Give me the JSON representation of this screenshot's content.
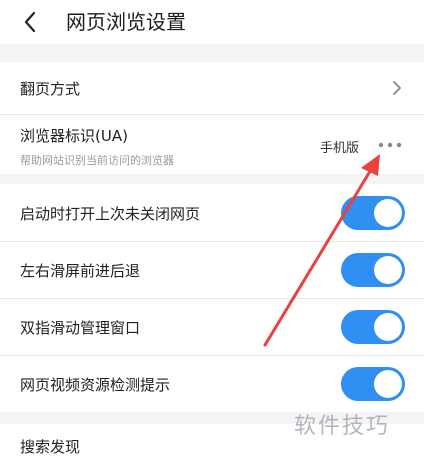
{
  "header": {
    "title": "网页浏览设置"
  },
  "settings": {
    "page_turn": {
      "label": "翻页方式"
    },
    "ua": {
      "label": "浏览器标识(UA)",
      "subtitle": "帮助网站识别当前访问的浏览器",
      "value": "手机版"
    },
    "toggles": [
      {
        "label": "启动时打开上次未关闭网页",
        "on": true
      },
      {
        "label": "左右滑屏前进后退",
        "on": true
      },
      {
        "label": "双指滑动管理窗口",
        "on": true
      },
      {
        "label": "网页视频资源检测提示",
        "on": true
      }
    ],
    "search_discovery": {
      "label": "搜索发现"
    }
  },
  "overlay": {
    "watermark": "软件技巧"
  },
  "colors": {
    "toggle_on": "#2f8ff3",
    "arrow": "#e8413e",
    "background": "#f4f4f6"
  }
}
